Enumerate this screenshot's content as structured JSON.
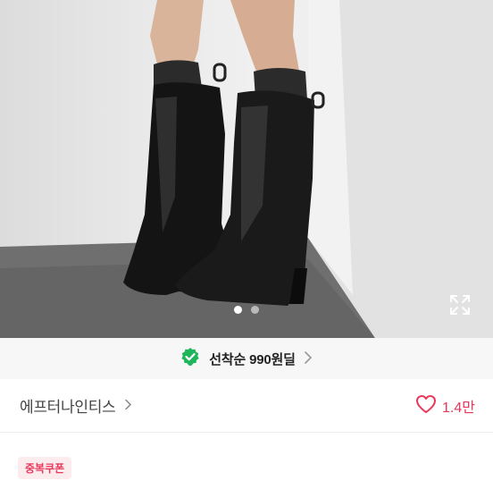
{
  "product": {
    "image_alt": "black slouchy knee-high wedge boots with lace socks",
    "carousel": {
      "current": 1,
      "total": 2
    },
    "expand_icon": "expand-icon"
  },
  "deal": {
    "icon": "verified-check-icon",
    "label": "선착순 990원딜",
    "accent": "#1fb55a"
  },
  "shop": {
    "name": "에프터나인티스",
    "chevron": "chevron-right-icon"
  },
  "like": {
    "icon": "heart-icon",
    "count": "1.4만",
    "color": "#e8385c"
  },
  "coupon": {
    "label": "중복쿠폰"
  },
  "title": ""
}
